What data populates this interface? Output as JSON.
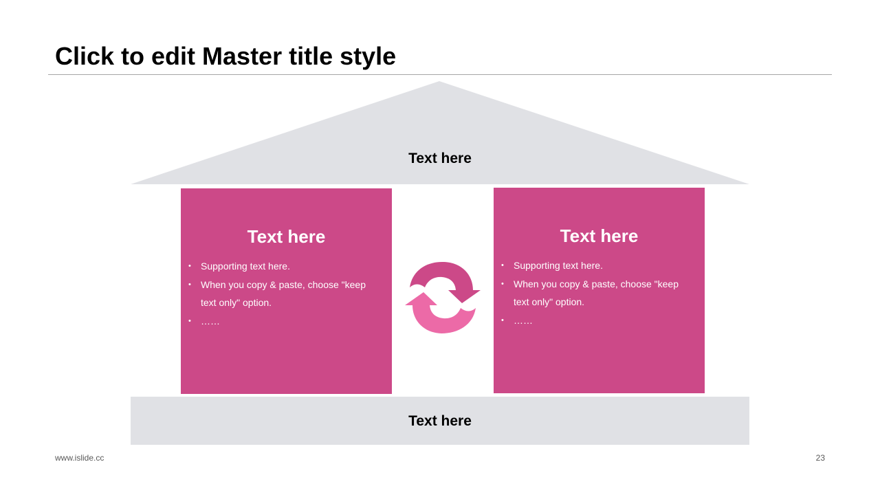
{
  "slide": {
    "title": "Click to edit Master title style",
    "footer_left": "www.islide.cc",
    "page_number": "23"
  },
  "diagram": {
    "roof_label": "Text here",
    "base_label": "Text here",
    "left_pillar": {
      "title": "Text here",
      "items": [
        "Supporting text here.",
        "When you copy & paste, choose \"keep text only\" option.",
        "……"
      ]
    },
    "right_pillar": {
      "title": "Text here",
      "items": [
        "Supporting text here.",
        "When you copy & paste, choose \"keep text only\" option.",
        "……"
      ]
    },
    "bullet_glyph": "•",
    "center_icon": "cycle-arrows-icon"
  },
  "colors": {
    "pillar": "#cc4988",
    "cycle_dark": "#cc4988",
    "cycle_light": "#ec6aa7",
    "roof_and_base": "#e0e1e5",
    "title_rule": "#a6a6a6"
  }
}
